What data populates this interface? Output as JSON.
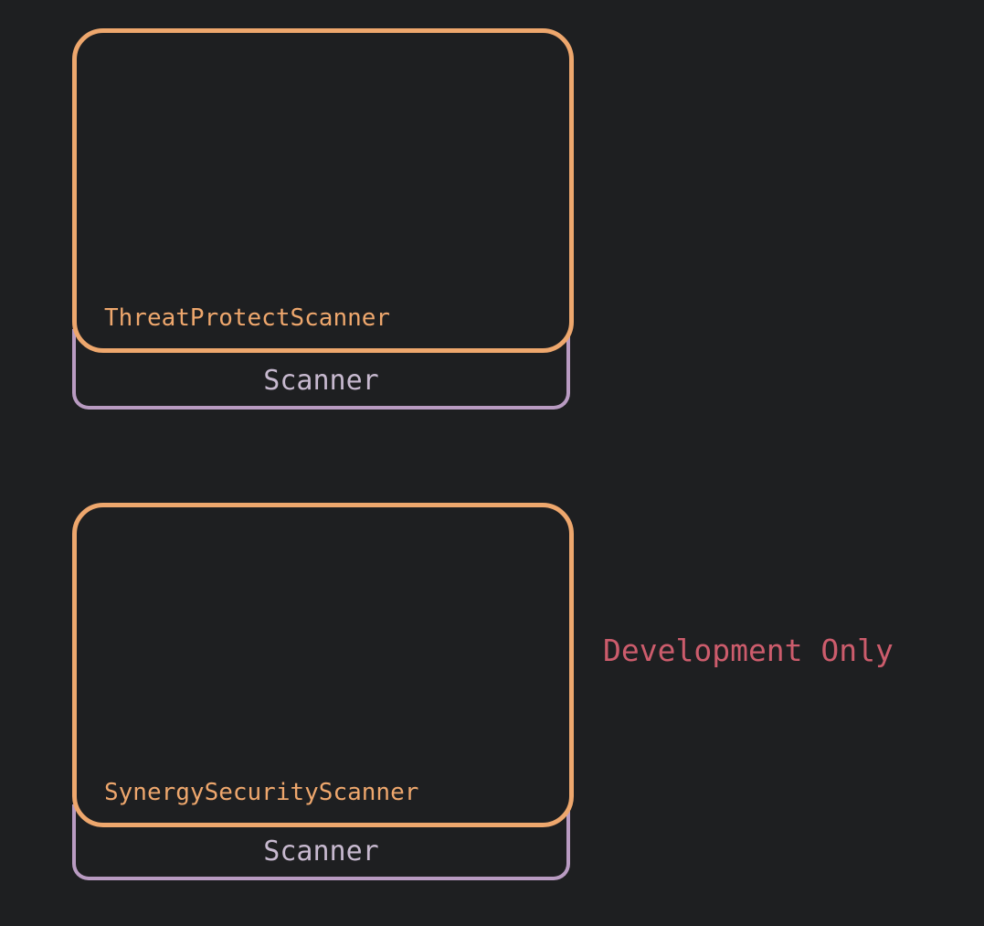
{
  "colors": {
    "background": "#1e1f21",
    "implementation_border": "#eea76d",
    "interface_border": "#b99bc2",
    "interface_text": "#c7b9cf",
    "note_text": "#cc5c6c"
  },
  "groups": [
    {
      "implementation": "ThreatProtectScanner",
      "interface": "Scanner",
      "note": ""
    },
    {
      "implementation": "SynergySecurityScanner",
      "interface": "Scanner",
      "note": "Development Only"
    }
  ]
}
